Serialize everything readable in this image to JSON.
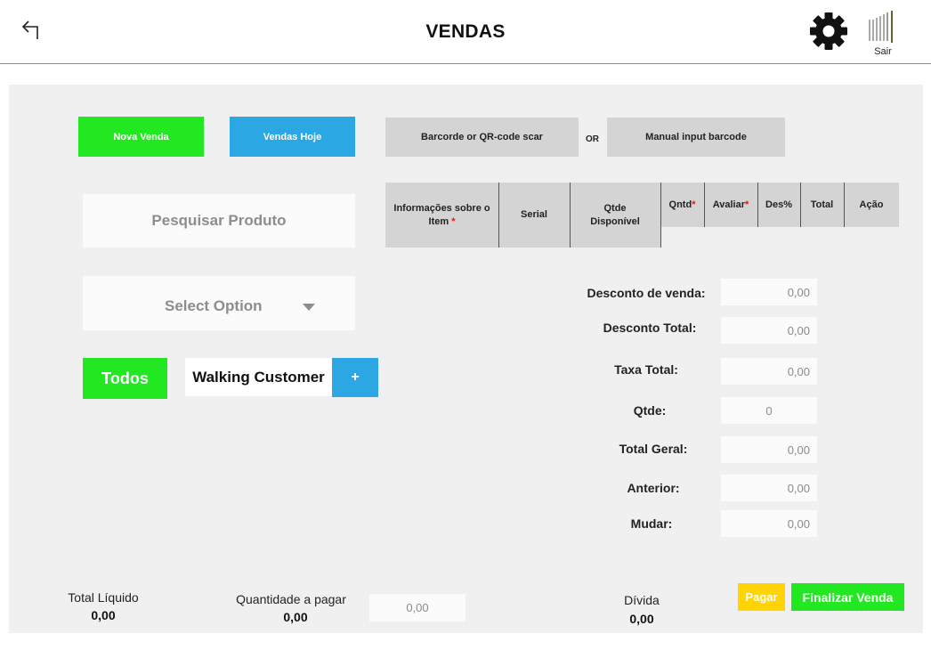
{
  "header": {
    "title": "VENDAS",
    "logout_label": "Sair"
  },
  "actions": {
    "nova_venda": "Nova Venda",
    "vendas_hoje": "Vendas Hoje",
    "barcode_scan": "Barcorde or QR-code scar",
    "or": "OR",
    "manual_barcode": "Manual input barcode"
  },
  "search": {
    "placeholder": "Pesquisar Produto"
  },
  "select": {
    "value": "Select Option"
  },
  "customer": {
    "filter_label": "Todos",
    "name": "Walking Customer",
    "add_label": "+"
  },
  "table": {
    "columns": [
      {
        "label": "Informações sobre o Item",
        "required": true
      },
      {
        "label": "Serial",
        "required": false
      },
      {
        "label": "Qtde Disponível",
        "required": false
      },
      {
        "label": "Qntd",
        "required": true
      },
      {
        "label": "Avaliar",
        "required": true
      },
      {
        "label": "Des%",
        "required": false
      },
      {
        "label": "Total",
        "required": false
      },
      {
        "label": "Ação",
        "required": false
      }
    ],
    "required_marker": "*"
  },
  "summary": [
    {
      "label": "Desconto de venda:",
      "value": "0,00"
    },
    {
      "label": "Desconto Total:",
      "value": "0,00"
    },
    {
      "label": "Taxa Total:",
      "value": "0,00"
    },
    {
      "label": "Qtde:",
      "value": "0"
    },
    {
      "label": "Total Geral:",
      "value": "0,00"
    },
    {
      "label": "Anterior:",
      "value": "0,00"
    },
    {
      "label": "Mudar:",
      "value": "0,00"
    }
  ],
  "footer": {
    "total_liquido_label": "Total Líquido",
    "total_liquido_value": "0,00",
    "quantidade_label": "Quantidade a pagar",
    "quantidade_value": "0,00",
    "pay_amount_placeholder": "0,00",
    "divida_label": "Dívida",
    "divida_value": "0,00",
    "pagar_label": "Pagar",
    "finalizar_label": "Finalizar Venda"
  },
  "colors": {
    "green": "#22e822",
    "blue": "#2ba7e3",
    "yellow": "#ffd400",
    "panel": "#f0f0f0",
    "required": "#e11111"
  }
}
